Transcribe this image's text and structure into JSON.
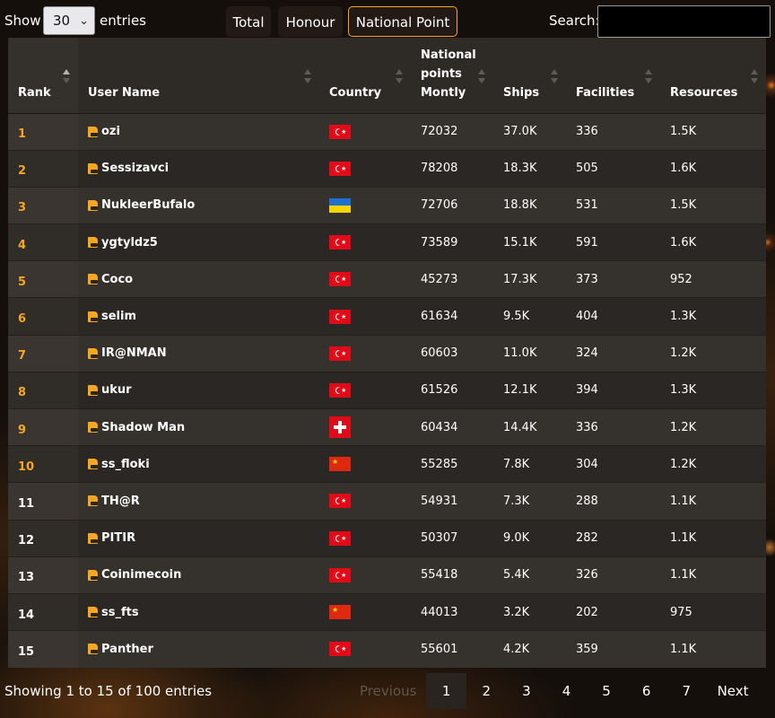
{
  "controls": {
    "show_label": "Show",
    "page_size": "30",
    "entries_label": "entries",
    "search_label": "Search:",
    "search_value": ""
  },
  "tabs": [
    {
      "label": "Total",
      "active": false
    },
    {
      "label": "Honour",
      "active": false
    },
    {
      "label": "National Point",
      "active": true
    }
  ],
  "columns": [
    "Rank",
    "User Name",
    "Country",
    "National points Montly",
    "Ships",
    "Facilities",
    "Resources"
  ],
  "rows": [
    {
      "rank": "1",
      "name": "ozi",
      "country": "tr",
      "points": "72032",
      "ships": "37.0K",
      "facilities": "336",
      "resources": "1.5K"
    },
    {
      "rank": "2",
      "name": "Sessizavci",
      "country": "tr",
      "points": "78208",
      "ships": "18.3K",
      "facilities": "505",
      "resources": "1.6K"
    },
    {
      "rank": "3",
      "name": "NukleerBufalo",
      "country": "ua",
      "points": "72706",
      "ships": "18.8K",
      "facilities": "531",
      "resources": "1.5K"
    },
    {
      "rank": "4",
      "name": "ygtyldz5",
      "country": "tr",
      "points": "73589",
      "ships": "15.1K",
      "facilities": "591",
      "resources": "1.6K"
    },
    {
      "rank": "5",
      "name": "Coco",
      "country": "tr",
      "points": "45273",
      "ships": "17.3K",
      "facilities": "373",
      "resources": "952"
    },
    {
      "rank": "6",
      "name": "selim",
      "country": "tr",
      "points": "61634",
      "ships": "9.5K",
      "facilities": "404",
      "resources": "1.3K"
    },
    {
      "rank": "7",
      "name": "IR@NMAN",
      "country": "tr",
      "points": "60603",
      "ships": "11.0K",
      "facilities": "324",
      "resources": "1.2K"
    },
    {
      "rank": "8",
      "name": "ukur",
      "country": "tr",
      "points": "61526",
      "ships": "12.1K",
      "facilities": "394",
      "resources": "1.3K"
    },
    {
      "rank": "9",
      "name": "Shadow Man",
      "country": "ch",
      "points": "60434",
      "ships": "14.4K",
      "facilities": "336",
      "resources": "1.2K"
    },
    {
      "rank": "10",
      "name": "ss_floki",
      "country": "cn",
      "points": "55285",
      "ships": "7.8K",
      "facilities": "304",
      "resources": "1.2K"
    },
    {
      "rank": "11",
      "name": "TH@R",
      "country": "tr",
      "points": "54931",
      "ships": "7.3K",
      "facilities": "288",
      "resources": "1.1K"
    },
    {
      "rank": "12",
      "name": "PITIR",
      "country": "tr",
      "points": "50307",
      "ships": "9.0K",
      "facilities": "282",
      "resources": "1.1K"
    },
    {
      "rank": "13",
      "name": "Coinimecoin",
      "country": "tr",
      "points": "55418",
      "ships": "5.4K",
      "facilities": "326",
      "resources": "1.1K"
    },
    {
      "rank": "14",
      "name": "ss_fts",
      "country": "cn",
      "points": "44013",
      "ships": "3.2K",
      "facilities": "202",
      "resources": "975"
    },
    {
      "rank": "15",
      "name": "Panther",
      "country": "tr",
      "points": "55601",
      "ships": "4.2K",
      "facilities": "359",
      "resources": "1.1K"
    }
  ],
  "footer": {
    "info": "Showing 1 to 15 of 100 entries",
    "previous": "Previous",
    "next": "Next",
    "pages": [
      "1",
      "2",
      "3",
      "4",
      "5",
      "6",
      "7"
    ],
    "current_page": "1"
  },
  "colors": {
    "accent": "#f5a623",
    "background": "#140f0b",
    "table": "#2c2824"
  },
  "icons": {
    "user": "user-badge-icon",
    "sort": "sort-arrows-icon",
    "select": "chevron-down-icon"
  }
}
